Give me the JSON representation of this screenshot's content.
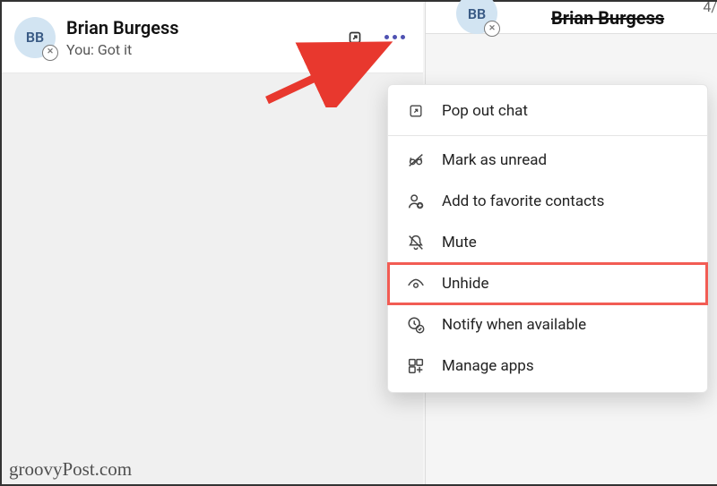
{
  "chat": {
    "avatar_initials": "BB",
    "name": "Brian Burgess",
    "preview": "You: Got it"
  },
  "right": {
    "avatar_initials": "BB",
    "name": "Brian Burgess",
    "date_partial": "4/"
  },
  "menu": {
    "pop_out": "Pop out chat",
    "mark_unread": "Mark as unread",
    "add_favorite": "Add to favorite contacts",
    "mute": "Mute",
    "unhide": "Unhide",
    "notify": "Notify when available",
    "manage_apps": "Manage apps"
  },
  "watermark": "groovyPost.com"
}
